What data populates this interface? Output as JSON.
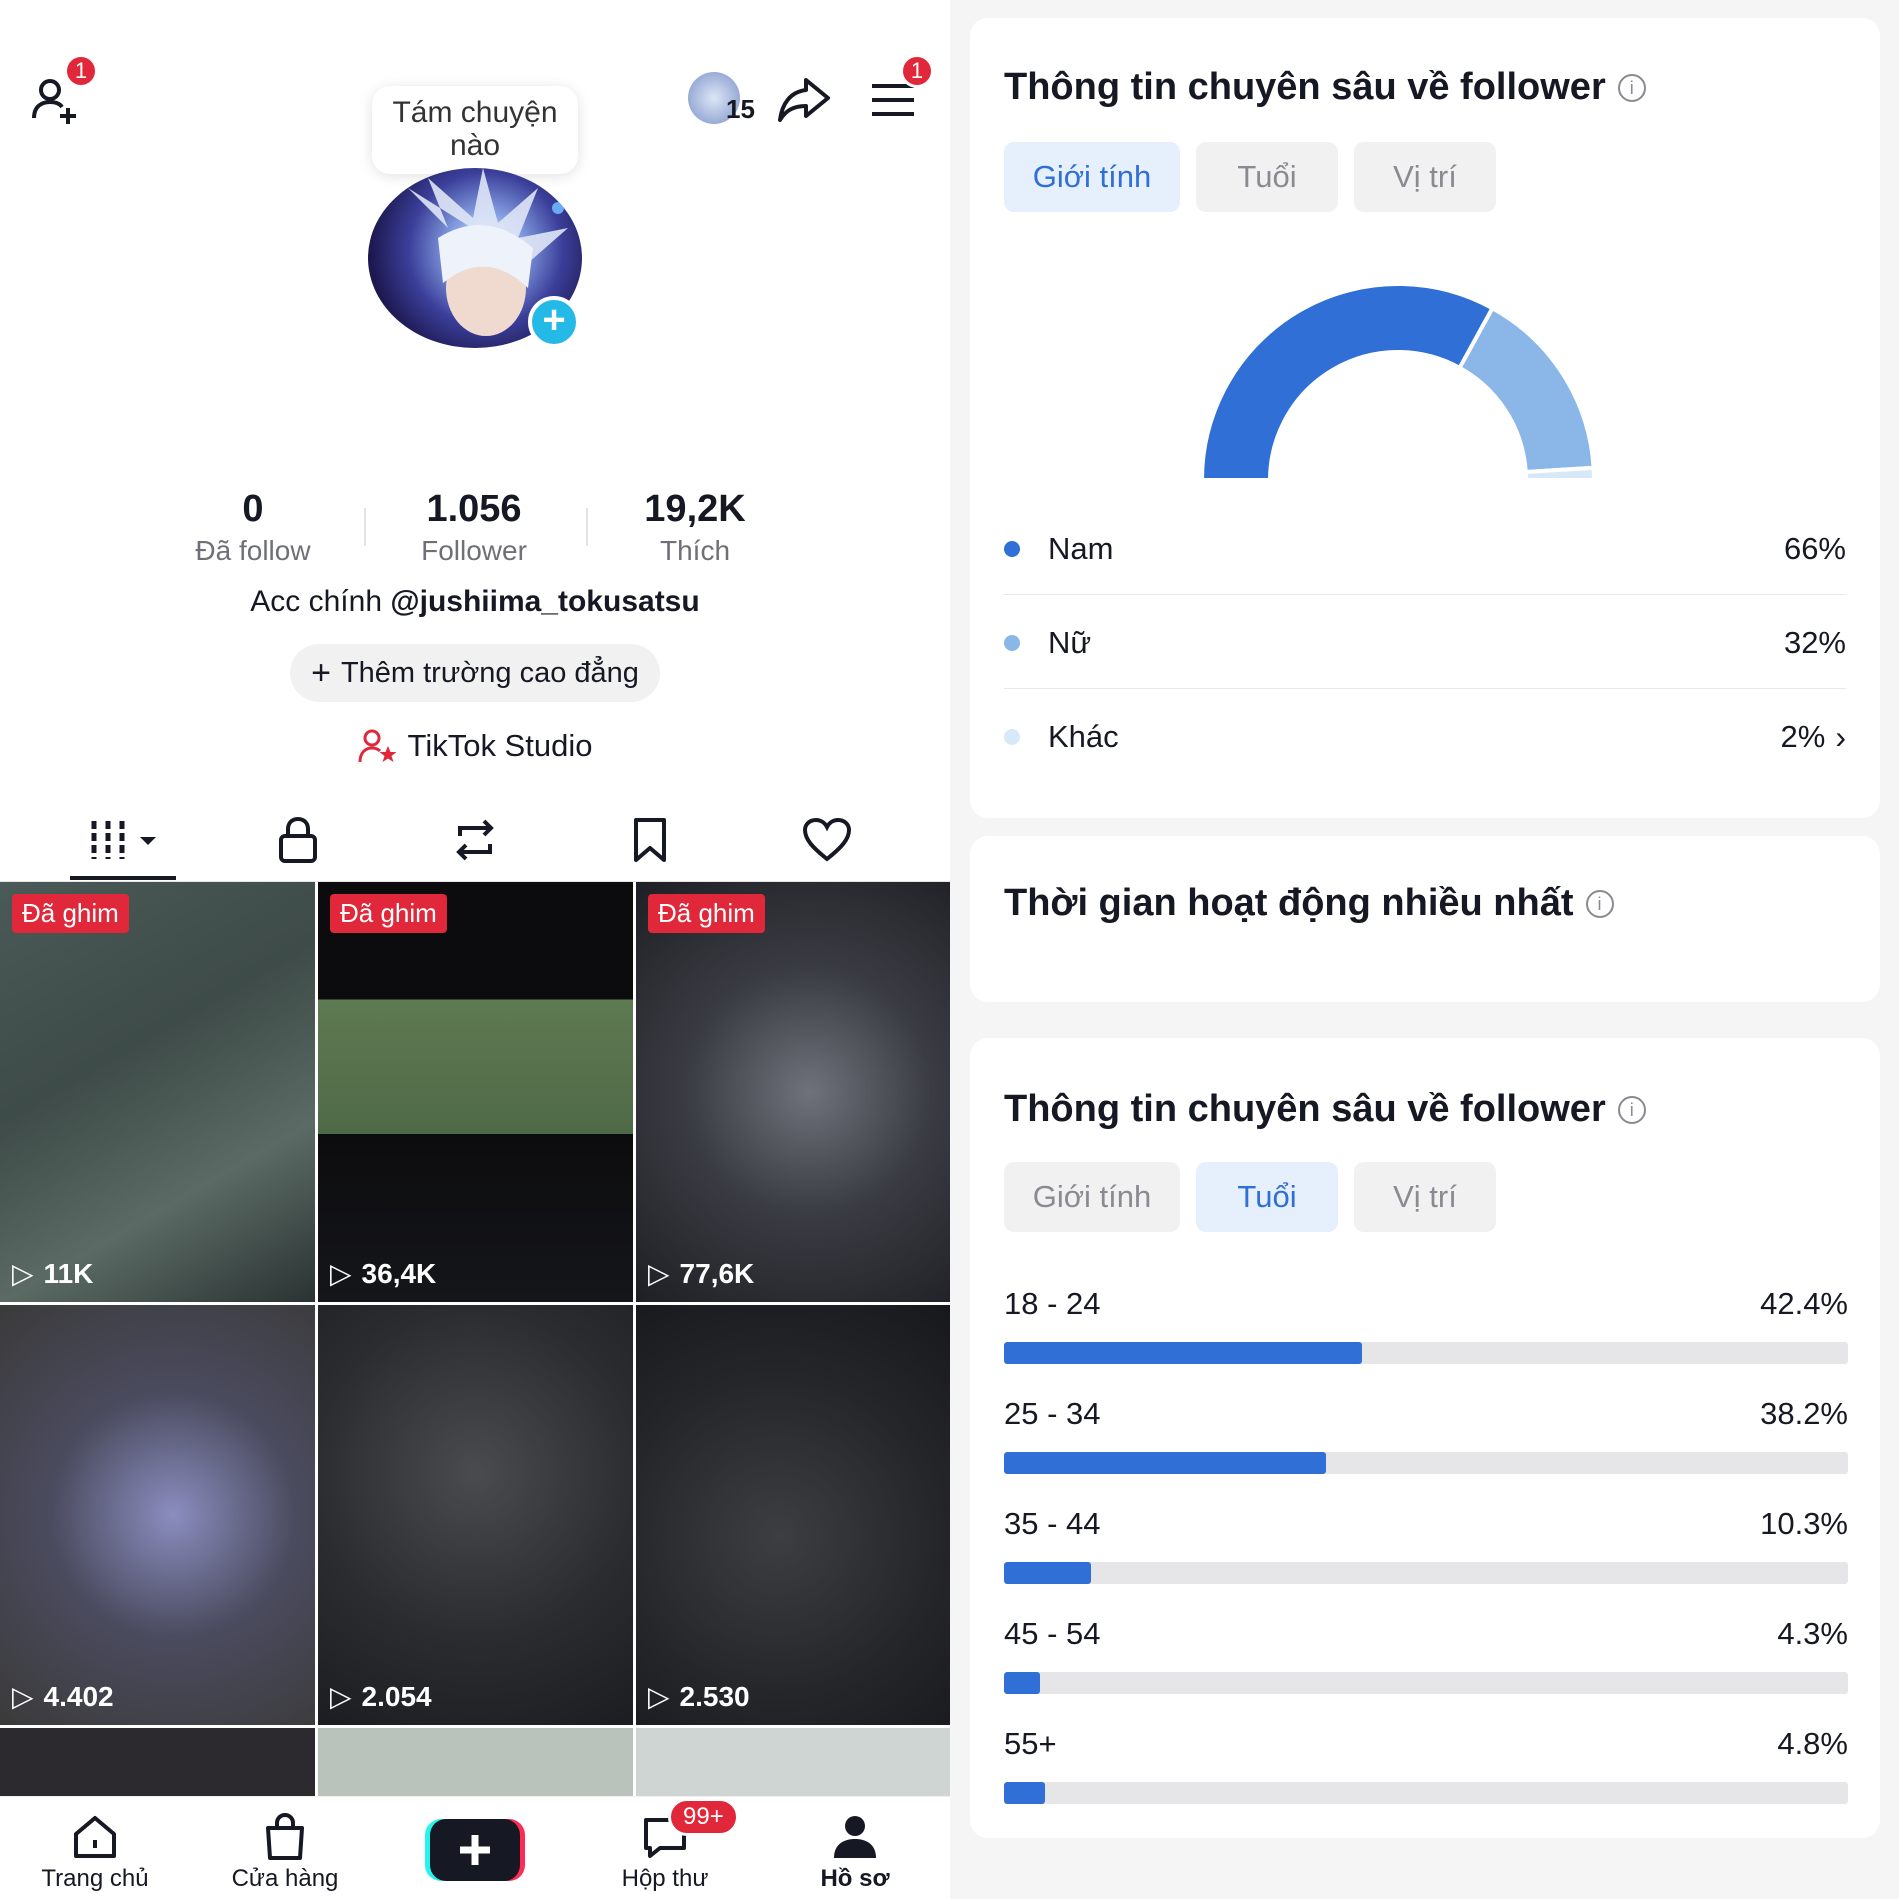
{
  "profile": {
    "add_friend_badge": "1",
    "note_bubble": "Tám chuyện nào",
    "visitor_count": "15",
    "menu_badge": "1",
    "stats": [
      {
        "value": "0",
        "label": "Đã follow"
      },
      {
        "value": "1.056",
        "label": "Follower"
      },
      {
        "value": "19,2K",
        "label": "Thích"
      }
    ],
    "bio_prefix": "Acc chính ",
    "bio_handle": "@jushiima_tokusatsu",
    "add_school_label": "Thêm trường cao đẳng",
    "studio_label": "TikTok Studio"
  },
  "content_tabs": [
    {
      "icon": "grid-icon"
    },
    {
      "icon": "lock-icon"
    },
    {
      "icon": "repost-icon"
    },
    {
      "icon": "bookmark-icon"
    },
    {
      "icon": "heart-icon"
    }
  ],
  "videos": [
    {
      "pinned": "Đã ghim",
      "views": "11K"
    },
    {
      "pinned": "Đã ghim",
      "views": "36,4K"
    },
    {
      "pinned": "Đã ghim",
      "views": "77,6K"
    },
    {
      "pinned": "",
      "views": "4.402"
    },
    {
      "pinned": "",
      "views": "2.054"
    },
    {
      "pinned": "",
      "views": "2.530"
    }
  ],
  "bottom_nav": {
    "home": "Trang chủ",
    "shop": "Cửa hàng",
    "inbox": "Hộp thư",
    "inbox_badge": "99+",
    "profile": "Hồ sơ"
  },
  "insights_gender": {
    "title": "Thông tin chuyên sâu về follower",
    "tabs": [
      "Giới tính",
      "Tuổi",
      "Vị trí"
    ],
    "active_tab": 0,
    "colors": [
      "#2f6fd6",
      "#8ab6e8",
      "#d7e8f8"
    ],
    "chart_data": {
      "type": "pie",
      "categories": [
        "Nam",
        "Nữ",
        "Khác"
      ],
      "values": [
        66,
        32,
        2
      ],
      "labels": [
        "66%",
        "32%",
        "2%"
      ]
    }
  },
  "active_time": {
    "title": "Thời gian hoạt động nhiều nhất"
  },
  "insights_age": {
    "title": "Thông tin chuyên sâu về follower",
    "tabs": [
      "Giới tính",
      "Tuổi",
      "Vị trí"
    ],
    "active_tab": 1,
    "chart_data": {
      "type": "bar",
      "categories": [
        "18 - 24",
        "25 - 34",
        "35 - 44",
        "45 - 54",
        "55+"
      ],
      "values": [
        42.4,
        38.2,
        10.3,
        4.3,
        4.8
      ],
      "labels": [
        "42.4%",
        "38.2%",
        "10.3%",
        "4.3%",
        "4.8%"
      ],
      "ylim": [
        0,
        100
      ]
    }
  }
}
